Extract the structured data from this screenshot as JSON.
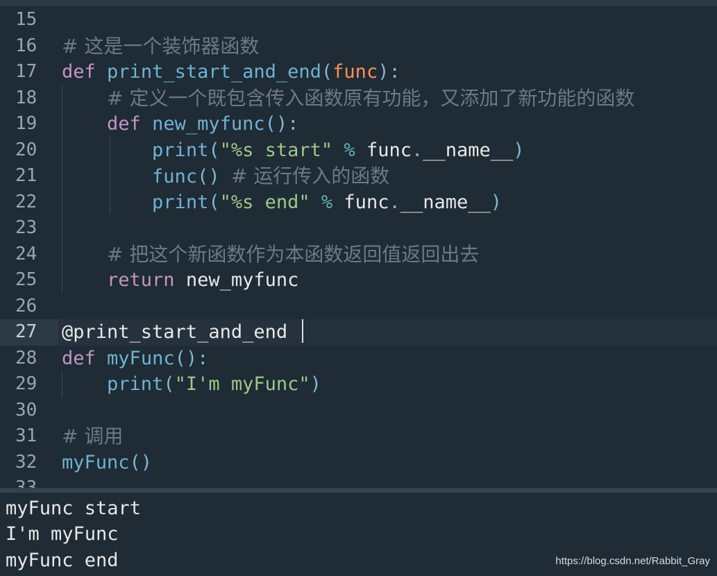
{
  "editor": {
    "current_line": "27",
    "lines": [
      {
        "num": "15",
        "tokens": []
      },
      {
        "num": "16",
        "tokens": [
          {
            "t": "# 这是一个装饰器函数",
            "c": "cm"
          }
        ]
      },
      {
        "num": "17",
        "tokens": [
          {
            "t": "def",
            "c": "kw"
          },
          {
            "t": " ",
            "c": "plain"
          },
          {
            "t": "print_start_and_end",
            "c": "fn"
          },
          {
            "t": "(",
            "c": "pun"
          },
          {
            "t": "func",
            "c": "par"
          },
          {
            "t": "):",
            "c": "pun"
          }
        ]
      },
      {
        "num": "18",
        "tokens": [
          {
            "t": "    ",
            "c": "plain"
          },
          {
            "t": "# 定义一个既包含传入函数原有功能，又添加了新功能的函数",
            "c": "cm"
          }
        ]
      },
      {
        "num": "19",
        "tokens": [
          {
            "t": "    ",
            "c": "plain"
          },
          {
            "t": "def",
            "c": "kw"
          },
          {
            "t": " ",
            "c": "plain"
          },
          {
            "t": "new_myfunc",
            "c": "fn"
          },
          {
            "t": "():",
            "c": "pun"
          }
        ]
      },
      {
        "num": "20",
        "tokens": [
          {
            "t": "        ",
            "c": "plain"
          },
          {
            "t": "print",
            "c": "fn"
          },
          {
            "t": "(",
            "c": "pun"
          },
          {
            "t": "\"%s start\"",
            "c": "str"
          },
          {
            "t": " ",
            "c": "plain"
          },
          {
            "t": "%",
            "c": "op"
          },
          {
            "t": " func",
            "c": "plain"
          },
          {
            "t": ".",
            "c": "pun"
          },
          {
            "t": "__name__",
            "c": "plain"
          },
          {
            "t": ")",
            "c": "pun"
          }
        ]
      },
      {
        "num": "21",
        "tokens": [
          {
            "t": "        ",
            "c": "plain"
          },
          {
            "t": "func",
            "c": "fn"
          },
          {
            "t": "()",
            "c": "pun"
          },
          {
            "t": " ",
            "c": "plain"
          },
          {
            "t": "# 运行传入的函数",
            "c": "cm"
          }
        ]
      },
      {
        "num": "22",
        "tokens": [
          {
            "t": "        ",
            "c": "plain"
          },
          {
            "t": "print",
            "c": "fn"
          },
          {
            "t": "(",
            "c": "pun"
          },
          {
            "t": "\"%s end\"",
            "c": "str"
          },
          {
            "t": " ",
            "c": "plain"
          },
          {
            "t": "%",
            "c": "op"
          },
          {
            "t": " func",
            "c": "plain"
          },
          {
            "t": ".",
            "c": "pun"
          },
          {
            "t": "__name__",
            "c": "plain"
          },
          {
            "t": ")",
            "c": "pun"
          }
        ]
      },
      {
        "num": "23",
        "tokens": []
      },
      {
        "num": "24",
        "tokens": [
          {
            "t": "    ",
            "c": "plain"
          },
          {
            "t": "# 把这个新函数作为本函数返回值返回出去",
            "c": "cm"
          }
        ]
      },
      {
        "num": "25",
        "tokens": [
          {
            "t": "    ",
            "c": "plain"
          },
          {
            "t": "return",
            "c": "kw"
          },
          {
            "t": " new_myfunc",
            "c": "plain"
          }
        ]
      },
      {
        "num": "26",
        "tokens": []
      },
      {
        "num": "27",
        "tokens": [
          {
            "t": "@print_start_and_end",
            "c": "plain"
          }
        ]
      },
      {
        "num": "28",
        "tokens": [
          {
            "t": "def",
            "c": "kw"
          },
          {
            "t": " ",
            "c": "plain"
          },
          {
            "t": "myFunc",
            "c": "fn"
          },
          {
            "t": "():",
            "c": "pun"
          }
        ]
      },
      {
        "num": "29",
        "tokens": [
          {
            "t": "    ",
            "c": "plain"
          },
          {
            "t": "print",
            "c": "fn"
          },
          {
            "t": "(",
            "c": "pun"
          },
          {
            "t": "\"I'm myFunc\"",
            "c": "str"
          },
          {
            "t": ")",
            "c": "pun"
          }
        ]
      },
      {
        "num": "30",
        "tokens": []
      },
      {
        "num": "31",
        "tokens": [
          {
            "t": "# 调用",
            "c": "cm"
          }
        ]
      },
      {
        "num": "32",
        "tokens": [
          {
            "t": "myFunc",
            "c": "fn"
          },
          {
            "t": "()",
            "c": "pun"
          }
        ]
      },
      {
        "num": "33",
        "tokens": []
      }
    ]
  },
  "output": {
    "lines": [
      "myFunc start",
      "I'm myFunc",
      "myFunc end"
    ]
  },
  "watermark": "https://blog.csdn.net/Rabbit_Gray"
}
